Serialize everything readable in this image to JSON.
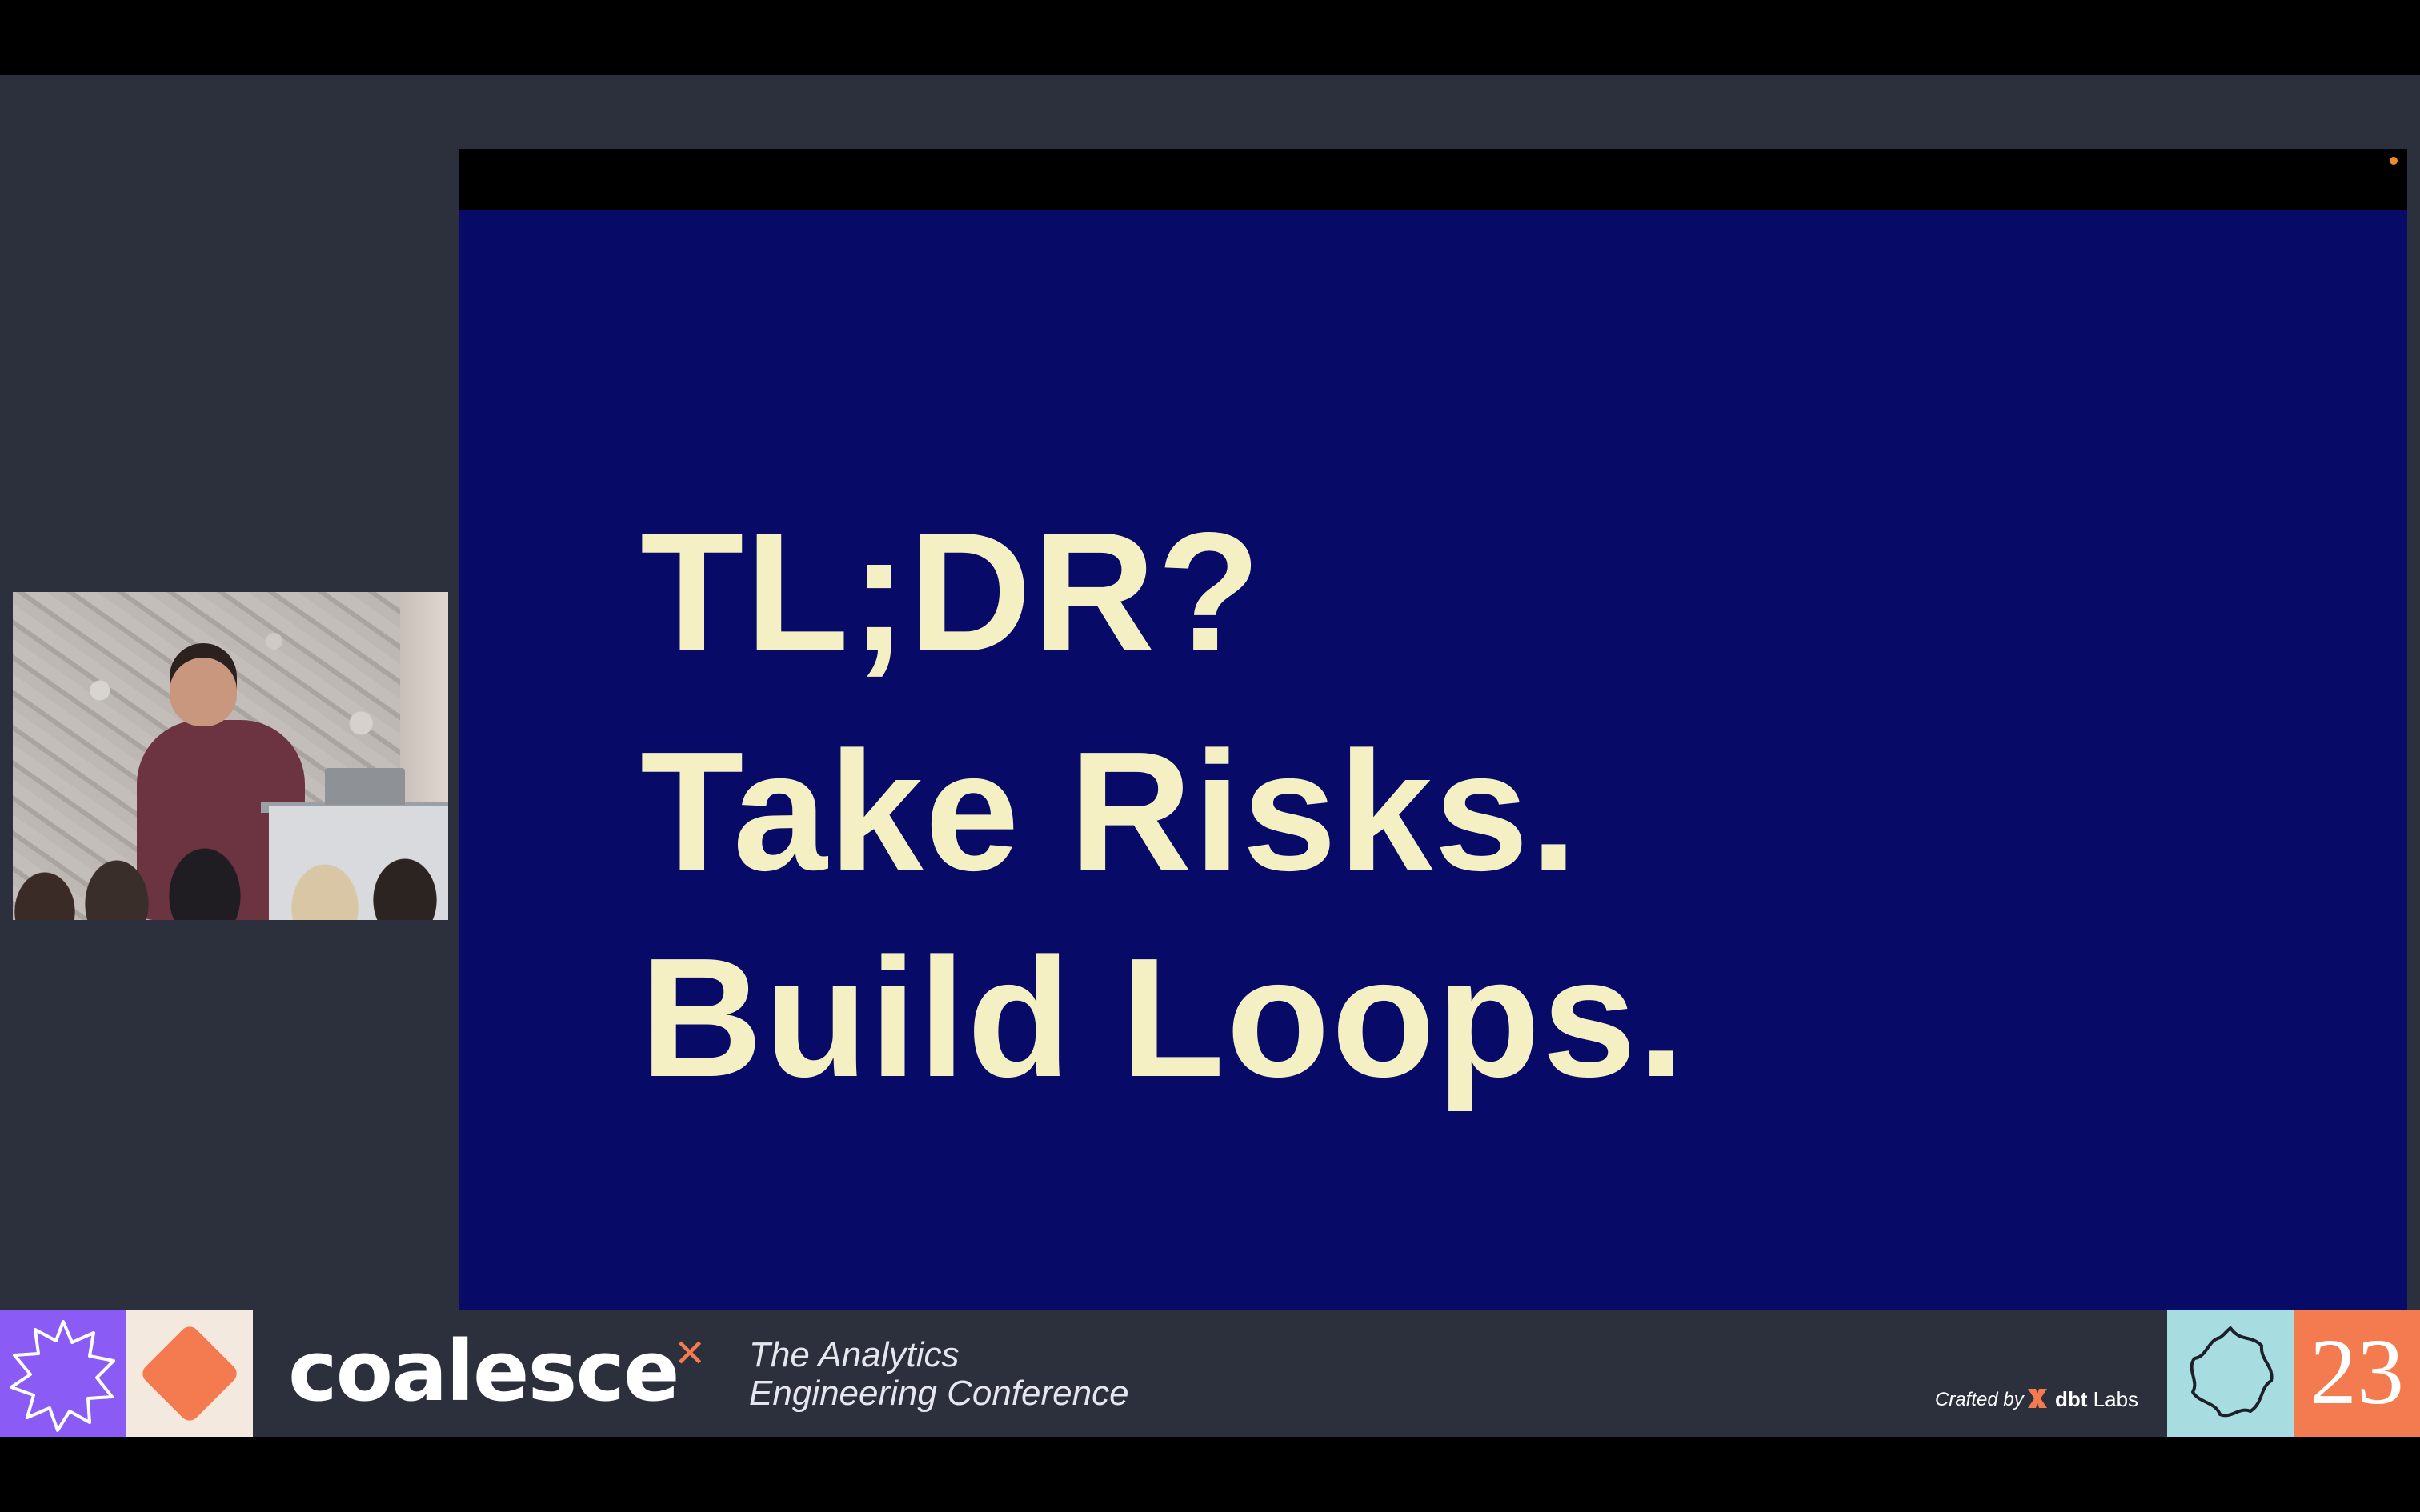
{
  "slide": {
    "lines": [
      "TL;DR?",
      "Take Risks.",
      "Build Loops."
    ],
    "text_color": "#f4f0c4",
    "background_color": "#070a66"
  },
  "branding": {
    "event_name": "coalesce",
    "tagline_line1": "The Analytics",
    "tagline_line2": "Engineering Conference",
    "crafted_by_label": "Crafted by",
    "company_name": "dbt",
    "company_suffix": "Labs",
    "year": "23",
    "colors": {
      "purple": "#8a5cf5",
      "cream": "#f3e9df",
      "teal": "#a7dde0",
      "orange": "#f47b4f",
      "bar": "#2c2f3c"
    },
    "icons": [
      "starburst-icon",
      "diamond-icon",
      "x-mark-icon",
      "dbt-logo-icon",
      "wavy-star-icon"
    ]
  },
  "camera": {
    "subject": "speaker-video-feed"
  }
}
